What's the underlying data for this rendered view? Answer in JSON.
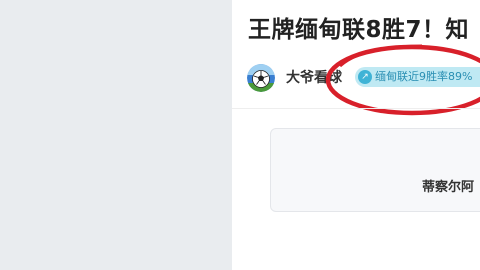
{
  "article": {
    "title": "王牌缅甸联8胜7！知",
    "author": {
      "name": "大爷看球",
      "avatar_icon": "soccer-ball-avatar"
    },
    "tag": {
      "icon": "arrow-up-icon",
      "label": "缅甸联近9胜率89%",
      "highlight_color": "#d8202a"
    }
  },
  "match_card": {
    "team_text": "蒂察尔阿"
  }
}
